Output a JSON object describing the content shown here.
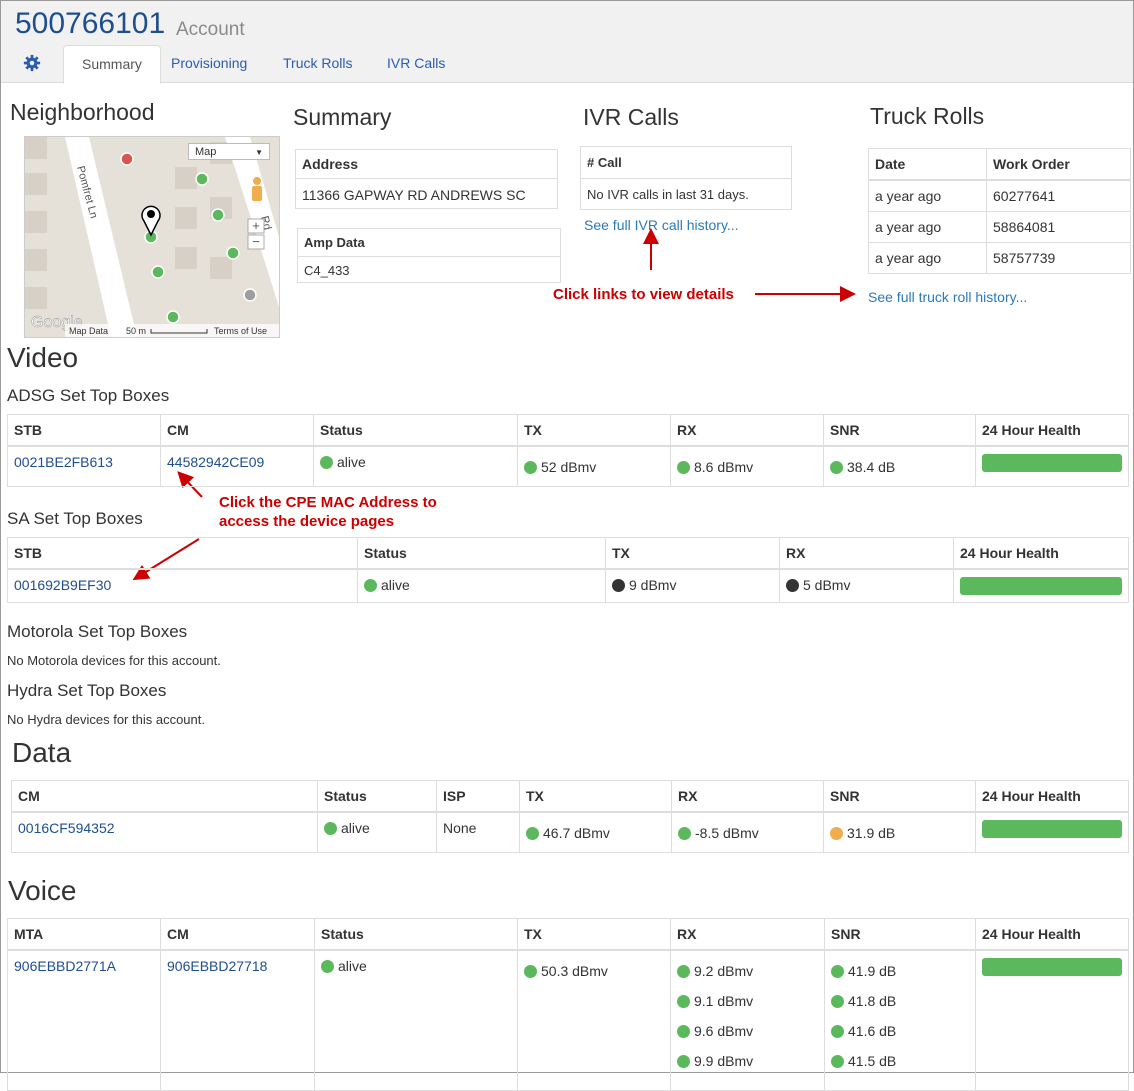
{
  "header": {
    "account_number": "500766101",
    "account_label": "Account",
    "tabs": [
      {
        "label": "Summary"
      },
      {
        "label": "Provisioning"
      },
      {
        "label": "Truck Rolls"
      },
      {
        "label": "IVR Calls"
      }
    ]
  },
  "neighborhood": {
    "title": "Neighborhood",
    "map": {
      "type_select": "Map",
      "street_name": "Pomfret Ln",
      "street2": "Rd",
      "credits": "Map Data",
      "scale": "50 m",
      "terms": "Terms of Use",
      "logo": "Google"
    }
  },
  "summary": {
    "title": "Summary",
    "address_header": "Address",
    "address_value": "11366 GAPWAY RD ANDREWS SC",
    "amp_header": "Amp Data",
    "amp_value": "C4_433"
  },
  "ivr": {
    "title": "IVR Calls",
    "col_header": "# Call",
    "empty_text": "No IVR calls in last 31 days.",
    "history_link": "See full IVR call history..."
  },
  "truck_rolls": {
    "title": "Truck Rolls",
    "headers": [
      "Date",
      "Work Order"
    ],
    "rows": [
      [
        "a year ago",
        "60277641"
      ],
      [
        "a year ago",
        "58864081"
      ],
      [
        "a year ago",
        "58757739"
      ]
    ],
    "history_link": "See full truck roll history..."
  },
  "annotations": {
    "links_note": "Click links to view details",
    "cpe_note_line1": "Click the CPE MAC Address to",
    "cpe_note_line2": "access the device pages"
  },
  "video": {
    "title": "Video",
    "adsg": {
      "title": "ADSG Set Top Boxes",
      "headers": [
        "STB",
        "CM",
        "Status",
        "TX",
        "RX",
        "SNR",
        "24 Hour Health"
      ],
      "row": {
        "stb": "0021BE2FB613",
        "cm": "44582942CE09",
        "status": "alive",
        "tx": "52 dBmv",
        "rx": "8.6 dBmv",
        "snr": "38.4 dB"
      }
    },
    "sa": {
      "title": "SA Set Top Boxes",
      "headers": [
        "STB",
        "Status",
        "TX",
        "RX",
        "24 Hour Health"
      ],
      "row": {
        "stb": "001692B9EF30",
        "status": "alive",
        "tx": "9 dBmv",
        "rx": "5 dBmv"
      }
    },
    "motorola": {
      "title": "Motorola Set Top Boxes",
      "empty_text": "No Motorola devices for this account."
    },
    "hydra": {
      "title": "Hydra Set Top Boxes",
      "empty_text": "No Hydra devices for this account."
    }
  },
  "data": {
    "title": "Data",
    "headers": [
      "CM",
      "Status",
      "ISP",
      "TX",
      "RX",
      "SNR",
      "24 Hour Health"
    ],
    "row": {
      "cm": "0016CF594352",
      "status": "alive",
      "isp": "None",
      "tx": "46.7 dBmv",
      "rx": "-8.5 dBmv",
      "snr": "31.9 dB"
    }
  },
  "voice": {
    "title": "Voice",
    "headers": [
      "MTA",
      "CM",
      "Status",
      "TX",
      "RX",
      "SNR",
      "24 Hour Health"
    ],
    "row": {
      "mta": "906EBBD2771A",
      "cm": "906EBBD27718",
      "status": "alive",
      "tx": "50.3 dBmv",
      "rx": [
        "9.2 dBmv",
        "9.1 dBmv",
        "9.6 dBmv",
        "9.9 dBmv"
      ],
      "snr": [
        "41.9 dB",
        "41.8 dB",
        "41.6 dB",
        "41.5 dB"
      ]
    }
  },
  "colors": {
    "brand_blue": "#1f4e8c",
    "link_blue": "#2a7ab8",
    "status_green": "#5cb85c",
    "status_orange": "#f0ad4e",
    "annotation_red": "#c00000"
  }
}
